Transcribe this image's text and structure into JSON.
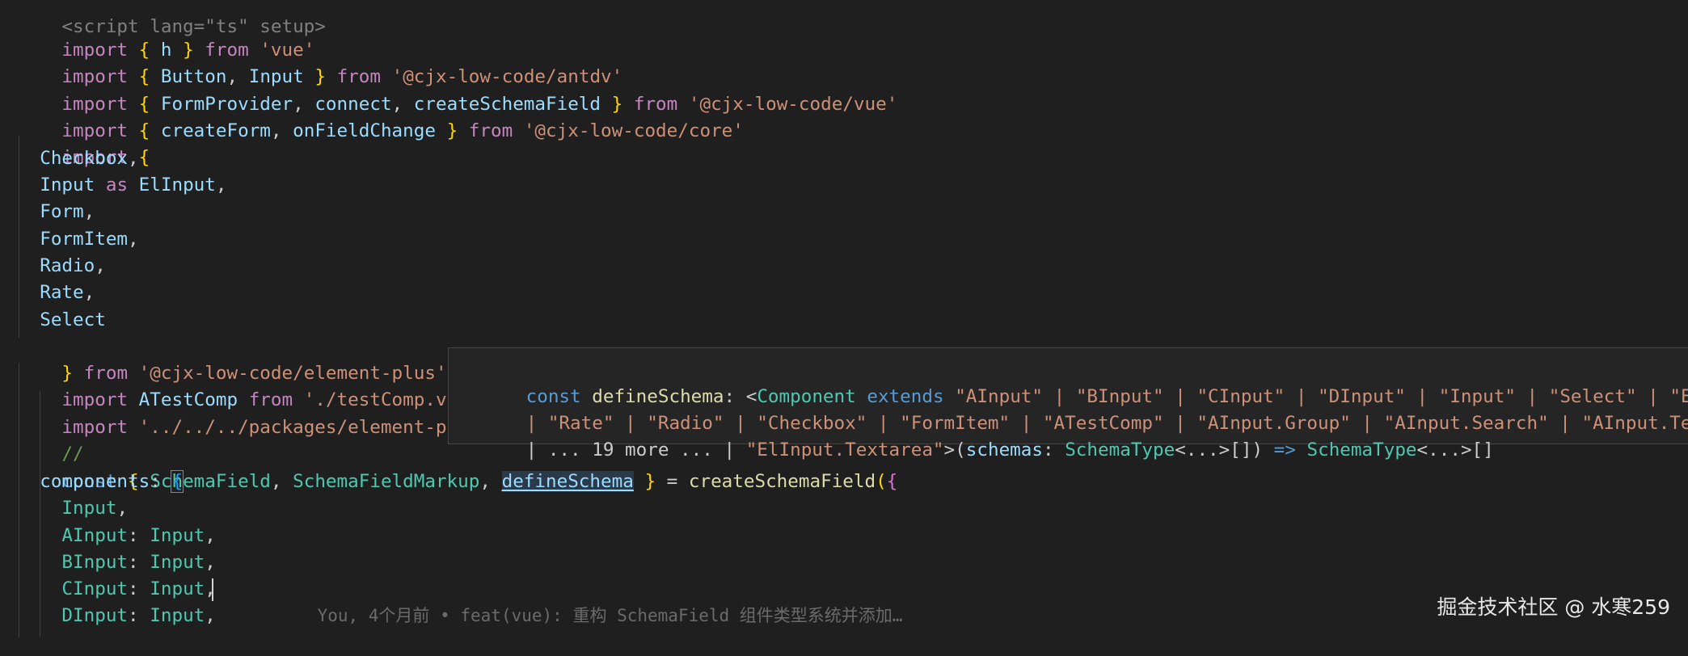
{
  "code": {
    "line0": {
      "tag": "<script lang=\"ts\" setup>"
    },
    "line1": {
      "kw": "import",
      "ob": "{",
      "id": " h ",
      "cb": "}",
      "from": "from",
      "src": "'vue'"
    },
    "line2": {
      "kw": "import",
      "ob": "{",
      "id1": "Button",
      "comma": ", ",
      "id2": "Input",
      "cb": "}",
      "from": "from",
      "src": "'@cjx-low-code/antdv'"
    },
    "line3": {
      "kw": "import",
      "ob": "{",
      "id1": "FormProvider",
      "c1": ", ",
      "id2": "connect",
      "c2": ", ",
      "id3": "createSchemaField",
      "cb": "}",
      "from": "from",
      "src": "'@cjx-low-code/vue'"
    },
    "line4": {
      "kw": "import",
      "ob": "{",
      "id1": "createForm",
      "c1": ", ",
      "id2": "onFieldChange",
      "cb": "}",
      "from": "from",
      "src": "'@cjx-low-code/core'"
    },
    "line5": {
      "kw": "import",
      "ob": "{"
    },
    "line6": {
      "id": "Checkbox",
      "punc": ","
    },
    "line7": {
      "id": "Input",
      "as": "as",
      "alias": "ElInput",
      "punc": ","
    },
    "line8": {
      "id": "Form",
      "punc": ","
    },
    "line9": {
      "id": "FormItem",
      "punc": ","
    },
    "line10": {
      "id": "Radio",
      "punc": ","
    },
    "line11": {
      "id": "Rate",
      "punc": ","
    },
    "line12": {
      "id": "Select"
    },
    "line13": {
      "cb": "}",
      "from": "from",
      "src": "'@cjx-low-code/element-plus'"
    },
    "line14": {
      "kw": "import",
      "id": "ATestComp",
      "from": "from",
      "src": "'./testComp.vue'"
    },
    "line15": {
      "kw": "import",
      "src": "'../../../packages/element-plus/d"
    },
    "line16": {
      "comment": "//"
    },
    "line17": {
      "const": "const",
      "ob": "{",
      "id1": "SchemaField",
      "c1": ", ",
      "id2": "SchemaFieldMarkup",
      "c2": ", ",
      "id3": "defineSchema",
      "cb": "}",
      "eq": " = ",
      "fn": "createSchemaField",
      "paren": "(",
      "ob2": "{"
    },
    "line18": {
      "key": "components",
      "colon": ": ",
      "ob": "{"
    },
    "line19": {
      "id": "Input",
      "punc": ","
    },
    "line20": {
      "key": "AInput",
      "colon": ": ",
      "val": "Input",
      "punc": ","
    },
    "line21": {
      "key": "BInput",
      "colon": ": ",
      "val": "Input",
      "punc": ","
    },
    "line22": {
      "key": "CInput",
      "colon": ": ",
      "val": "Input",
      "punc": ","
    },
    "line23": {
      "key": "DInput",
      "colon": ": ",
      "val": "Input",
      "punc": ","
    }
  },
  "blame": "You, 4个月前 • feat(vue): 重构 SchemaField 组件类型系统并添加…",
  "hover": {
    "l1": {
      "const": "const",
      "name": " defineSchema",
      "colon": ": ",
      "lt": "<",
      "comp": "Component",
      "ext": " extends ",
      "items": "\"AInput\" | \"BInput\" | \"CInput\" | \"DInput\" | \"Input\" | \"Select\" | \"ElInput\""
    },
    "l2": {
      "items": "| \"Rate\" | \"Radio\" | \"Checkbox\" | \"FormItem\" | \"ATestComp\" | \"AInput.Group\" | \"AInput.Search\" | \"AInput.TextArea\""
    },
    "l3": {
      "pre": "| ... 19 more ... | ",
      "last": "\"ElInput.Textarea\"",
      "gt": ">(",
      "param": "schemas",
      "pc": ": ",
      "t1": "SchemaType",
      "g1": "<...>[]",
      "close": ") ",
      "arrow": "=>",
      "sp": " ",
      "t2": "SchemaType",
      "g2": "<...>[]"
    }
  },
  "watermark": "掘金技术社区 @ 水寒259"
}
